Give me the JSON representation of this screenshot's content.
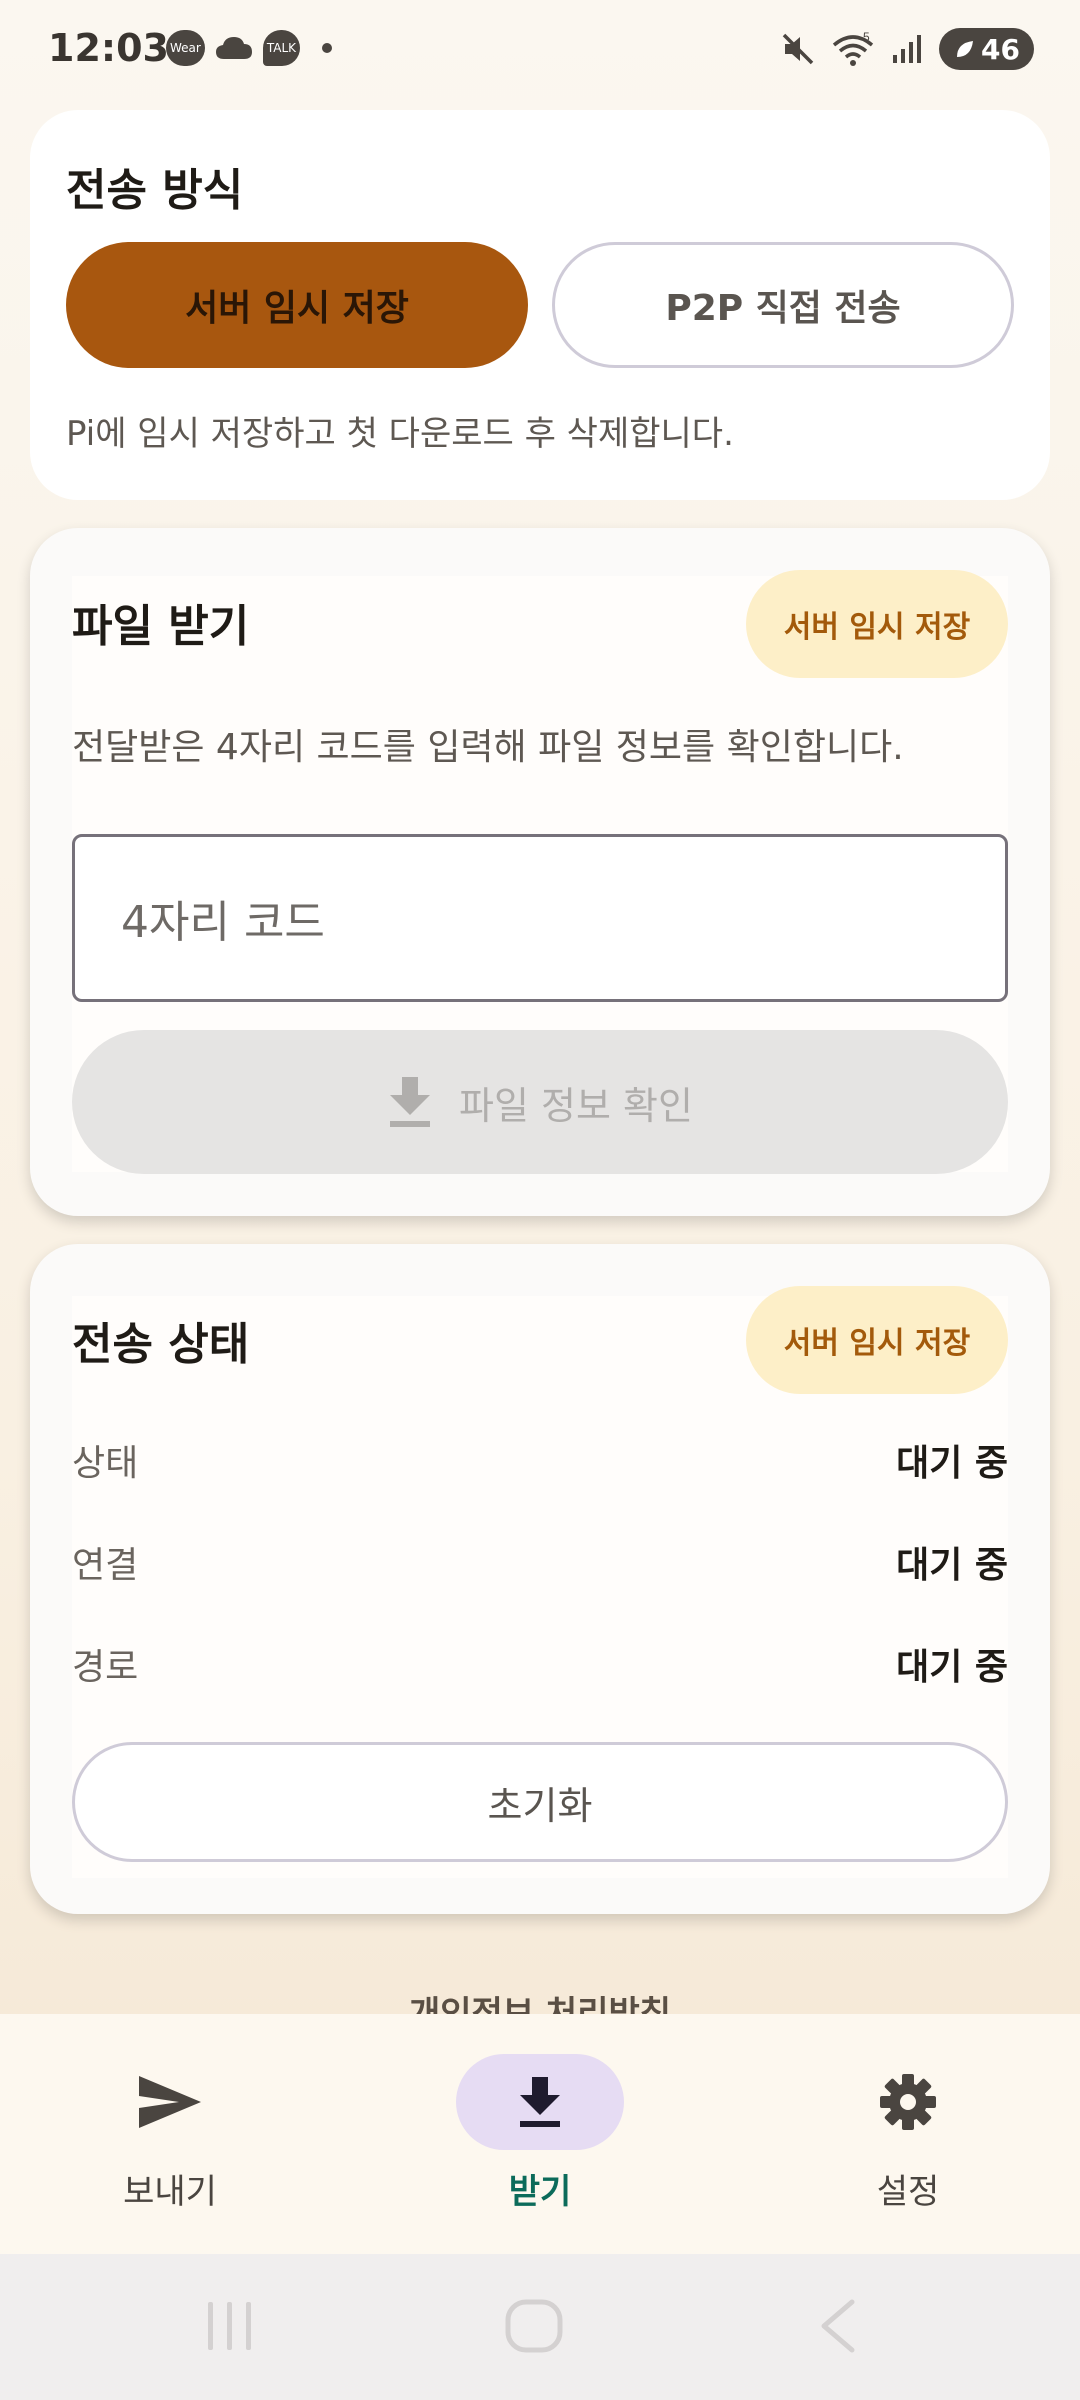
{
  "status_bar": {
    "time": "12:03",
    "left_icons": [
      "Wear",
      "cloud-icon",
      "TALK"
    ],
    "wifi_badge": "5",
    "battery": "46"
  },
  "transfer_method": {
    "title": "전송 방식",
    "options": [
      {
        "label": "서버 임시 저장",
        "selected": true
      },
      {
        "label": "P2P 직접 전송",
        "selected": false
      }
    ],
    "description": "Pi에 임시 저장하고 첫 다운로드 후 삭제합니다."
  },
  "receive_file": {
    "title": "파일 받기",
    "badge": "서버 임시 저장",
    "description": "전달받은 4자리 코드를 입력해 파일 정보를 확인합니다.",
    "code_input": {
      "placeholder": "4자리 코드",
      "value": ""
    },
    "check_button": {
      "label": "파일 정보 확인",
      "enabled": false,
      "icon": "download-icon"
    }
  },
  "transfer_status": {
    "title": "전송 상태",
    "badge": "서버 임시 저장",
    "rows": [
      {
        "label": "상태",
        "value": "대기 중"
      },
      {
        "label": "연결",
        "value": "대기 중"
      },
      {
        "label": "경로",
        "value": "대기 중"
      }
    ],
    "reset_button": "초기화"
  },
  "privacy_link": "개인정보 처리방침",
  "bottom_nav": {
    "items": [
      {
        "label": "보내기",
        "icon": "send-icon",
        "active": false
      },
      {
        "label": "받기",
        "icon": "download-icon",
        "active": true
      },
      {
        "label": "설정",
        "icon": "gear-icon",
        "active": false
      }
    ]
  },
  "colors": {
    "primary": "#a8570f",
    "badge_bg": "#fdefc8",
    "badge_text": "#a35a0b",
    "nav_active_bg": "#e6dcf3",
    "nav_active_text": "#0c6b5a"
  }
}
